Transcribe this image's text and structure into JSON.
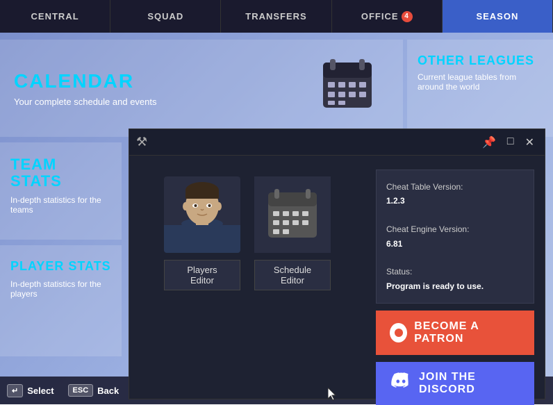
{
  "nav": {
    "items": [
      {
        "id": "central",
        "label": "CENTRAL",
        "active": false
      },
      {
        "id": "squad",
        "label": "SQUAD",
        "active": false
      },
      {
        "id": "transfers",
        "label": "TRANSFERS",
        "active": false
      },
      {
        "id": "office",
        "label": "OFFICE",
        "active": false,
        "badge": "4"
      },
      {
        "id": "season",
        "label": "SEASON",
        "active": true
      }
    ]
  },
  "cards": {
    "calendar": {
      "title": "CALENDAR",
      "subtitle": "Your complete schedule and events"
    },
    "other_leagues": {
      "title": "OTHER LEAGUES",
      "subtitle": "Current league tables from around the world"
    },
    "team_stats": {
      "title": "TEAM\nSTATS",
      "subtitle": "In-depth statistics for the teams"
    },
    "player_stats": {
      "title": "PLAYER STATS",
      "subtitle": "In-depth statistics for the players"
    }
  },
  "modal": {
    "editors": [
      {
        "id": "players-editor",
        "label": "Players Editor"
      },
      {
        "id": "schedule-editor",
        "label": "Schedule Editor"
      }
    ],
    "info": {
      "cheat_table_label": "Cheat Table Version:",
      "cheat_table_value": "1.2.3",
      "cheat_engine_label": "Cheat Engine Version:",
      "cheat_engine_value": "6.81",
      "status_label": "Status:",
      "status_value": "Program is ready to use."
    },
    "patron_label": "BECOME A PATRON",
    "discord_label": "JOIN THE\nDISCORD"
  },
  "bottom_bar": {
    "select_label": "Select",
    "back_label": "Back"
  }
}
